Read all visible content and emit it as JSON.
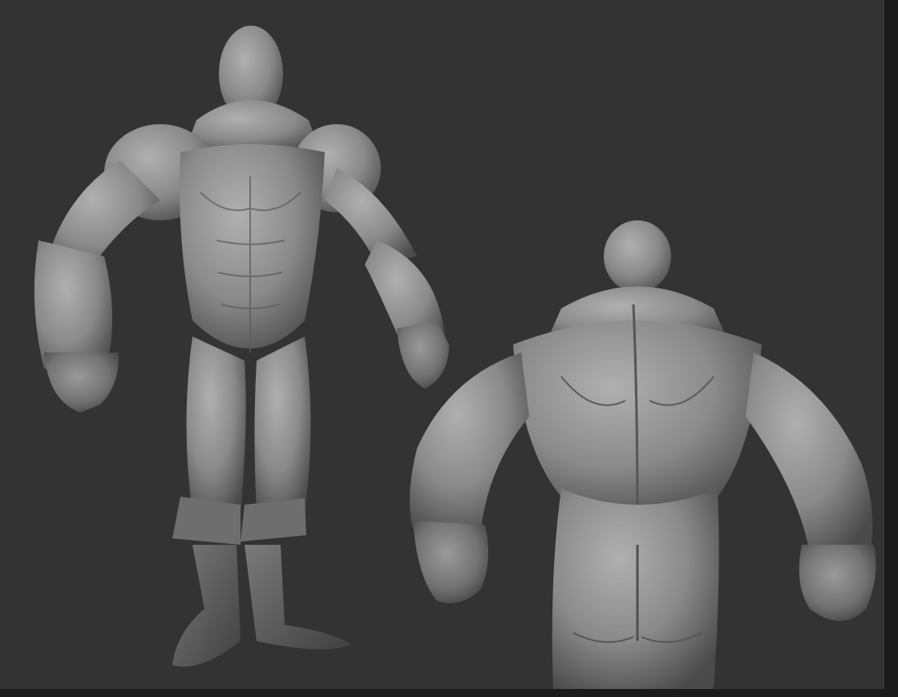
{
  "viewport": {
    "background": "#333333",
    "frame_color": "#1b1b1b"
  },
  "model": {
    "material_color": "#8a8a8a",
    "shadow_color": "#3e3e3e",
    "highlight_color": "#b4b4b4",
    "views": [
      {
        "name": "front-three-quarter-view"
      },
      {
        "name": "back-view"
      }
    ]
  }
}
